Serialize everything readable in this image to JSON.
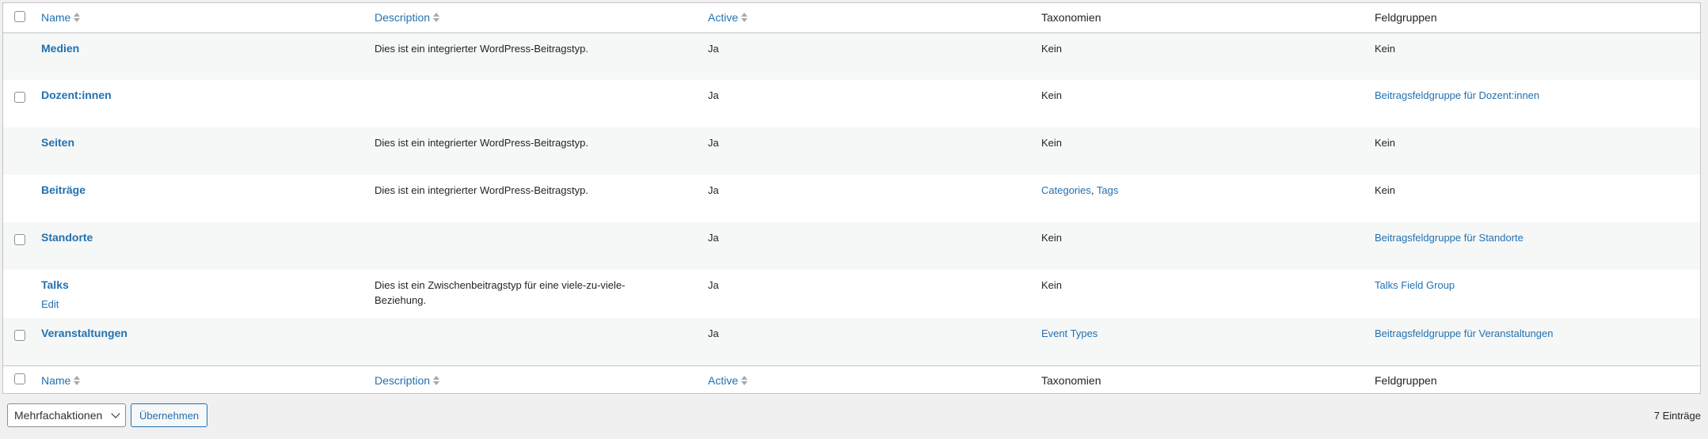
{
  "columns": {
    "name": "Name",
    "description": "Description",
    "active": "Active",
    "taxonomies": "Taxonomien",
    "field_groups": "Feldgruppen"
  },
  "rows": [
    {
      "name": "Medien",
      "description": "Dies ist ein integrierter WordPress-Beitragstyp.",
      "active": "Ja",
      "taxonomies": [
        "Kein"
      ],
      "field_groups": "Kein",
      "checkbox": false
    },
    {
      "name": "Dozent:innen",
      "description": "",
      "active": "Ja",
      "taxonomies": [
        "Kein"
      ],
      "field_groups": "Beitragsfeldgruppe für Dozent:innen",
      "checkbox": true
    },
    {
      "name": "Seiten",
      "description": "Dies ist ein integrierter WordPress-Beitragstyp.",
      "active": "Ja",
      "taxonomies": [
        "Kein"
      ],
      "field_groups": "Kein",
      "checkbox": false
    },
    {
      "name": "Beiträge",
      "description": "Dies ist ein integrierter WordPress-Beitragstyp.",
      "active": "Ja",
      "taxonomies": [
        "Categories",
        "Tags"
      ],
      "field_groups": "Kein",
      "checkbox": false
    },
    {
      "name": "Standorte",
      "description": "",
      "active": "Ja",
      "taxonomies": [
        "Kein"
      ],
      "field_groups": "Beitragsfeldgruppe für Standorte",
      "checkbox": true
    },
    {
      "name": "Talks",
      "row_action": "Edit",
      "description": "Dies ist ein Zwischenbeitragstyp für eine viele-zu-viele-Beziehung.",
      "active": "Ja",
      "taxonomies": [
        "Kein"
      ],
      "field_groups": "Talks Field Group",
      "checkbox": false
    },
    {
      "name": "Veranstaltungen",
      "description": "",
      "active": "Ja",
      "taxonomies": [
        "Event Types"
      ],
      "field_groups": "Beitragsfeldgruppe für Veranstaltungen",
      "checkbox": true
    }
  ],
  "taxonomy_separator": ", ",
  "bulk_actions": {
    "selected": "Mehrfachaktionen",
    "apply_label": "Übernehmen"
  },
  "item_count": "7 Einträge",
  "icons": {
    "sort": "sort-arrows-icon",
    "dropdown": "chevron-down-icon"
  },
  "colors": {
    "link": "#2271b1",
    "border": "#c3c4c7",
    "alt_row": "#f6f7f7",
    "background": "#f0f0f1"
  }
}
